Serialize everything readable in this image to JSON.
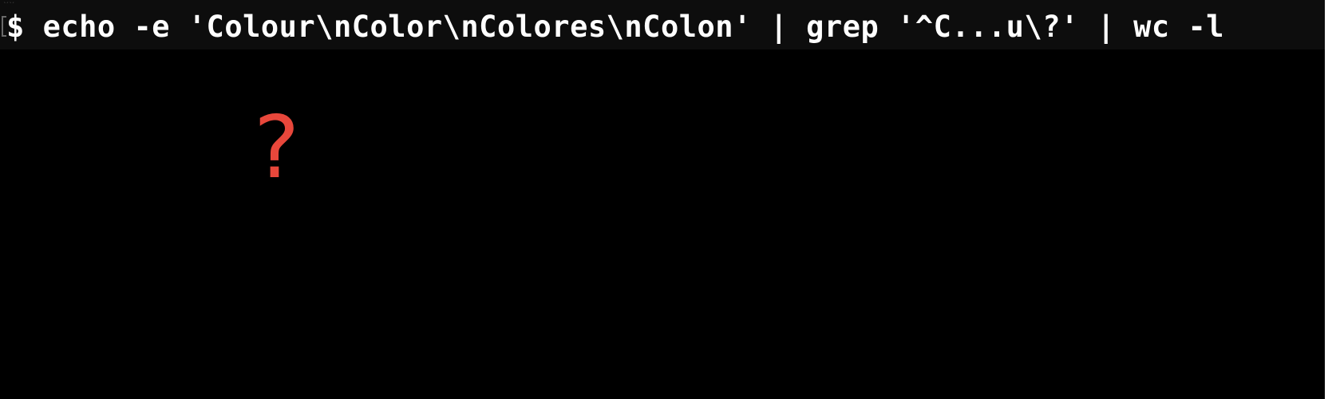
{
  "terminal": {
    "prompt": "$",
    "command": "echo -e 'Colour\\nColor\\nColores\\nColon' | grep '^C...u\\?' | wc -l",
    "output_placeholder": "?"
  },
  "colors": {
    "background": "#000000",
    "command_bar": "#0d0d0d",
    "text": "#ffffff",
    "accent": "#e8473b"
  }
}
